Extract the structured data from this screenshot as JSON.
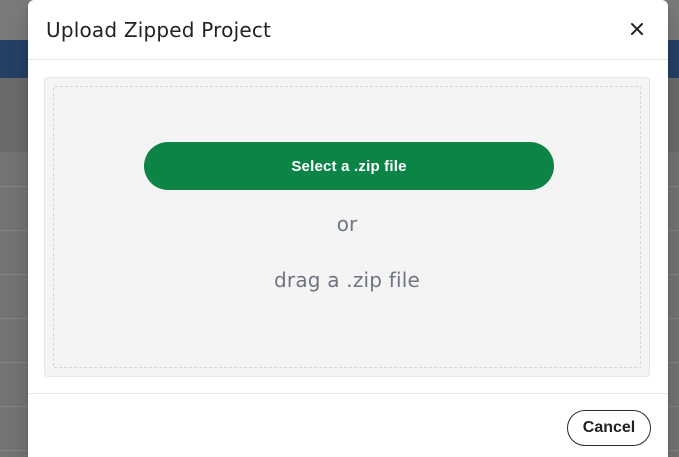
{
  "modal": {
    "title": "Upload Zipped Project",
    "close_icon": "close-icon",
    "dropzone": {
      "select_button_label": "Select a .zip file",
      "or_text": "or",
      "drag_text": "drag a .zip file"
    },
    "footer": {
      "cancel_label": "Cancel"
    }
  },
  "colors": {
    "primary_green": "#0b8446",
    "overlay_gray": "#7a7a7a",
    "top_nav_blue": "#1d3b63"
  }
}
